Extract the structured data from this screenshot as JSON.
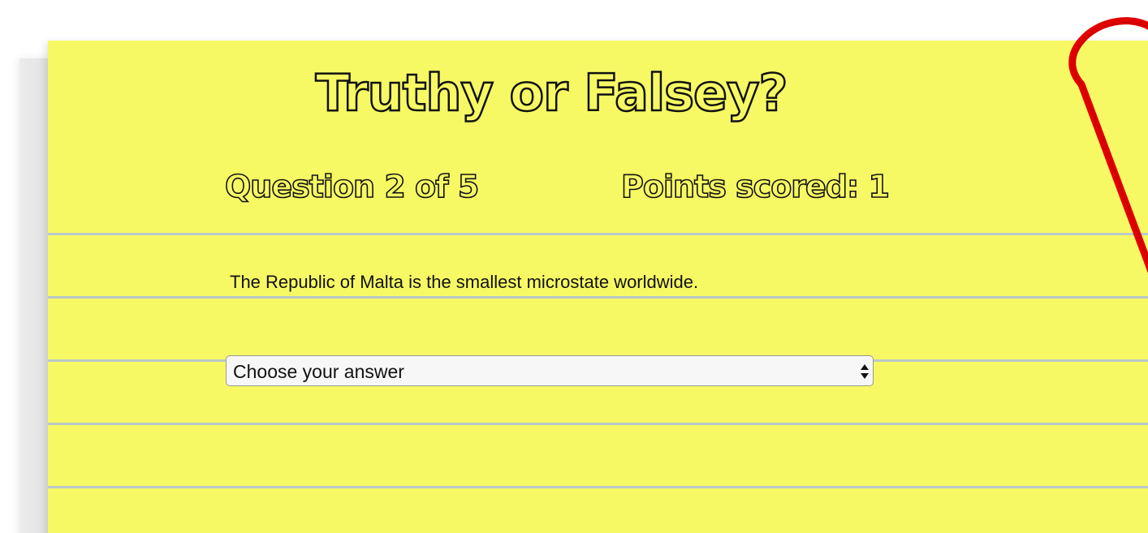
{
  "quiz": {
    "title": "Truthy or Falsey?",
    "question_status": "Question 2 of 5",
    "points_status": "Points scored: 1",
    "question_text": "The Republic of Malta is the smallest microstate worldwide.",
    "answer_select": {
      "selected": "Choose your answer"
    }
  },
  "icons": {
    "select_arrows": "updown-chevron-icon",
    "decoration": "paperclip-icon"
  },
  "colors": {
    "paper": "#f7f964",
    "rule_line": "#b9c8c8",
    "paperclip": "#e00000",
    "text": "#111111"
  }
}
